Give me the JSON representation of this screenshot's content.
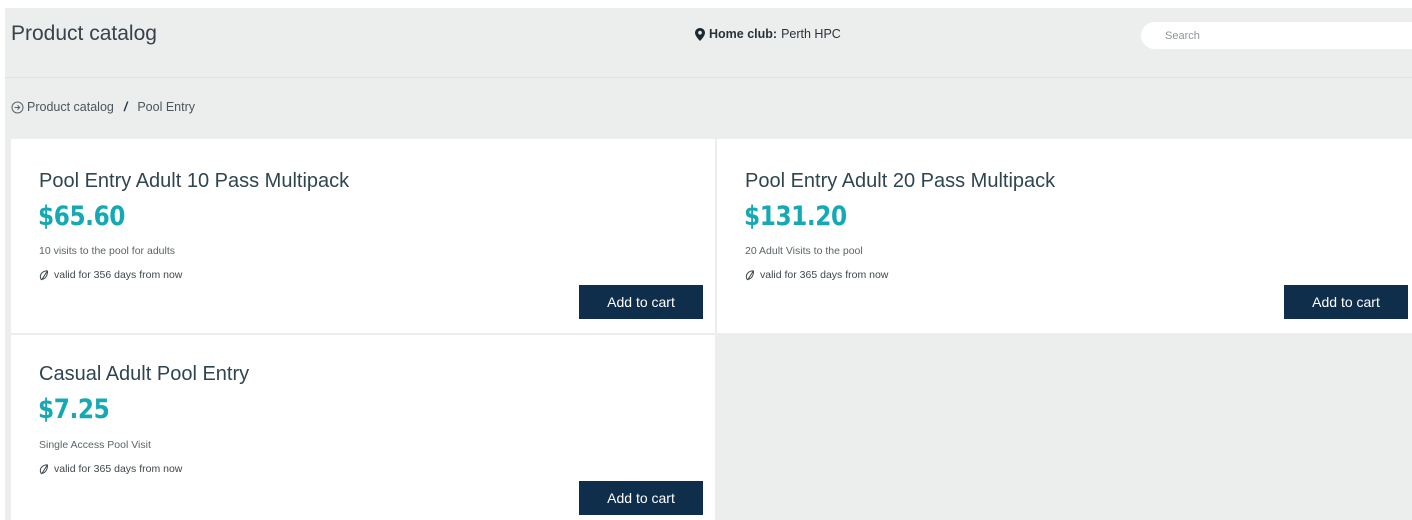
{
  "header": {
    "title": "Product catalog",
    "home_club_label": "Home club:",
    "home_club_value": "Perth HPC",
    "search_placeholder": "Search"
  },
  "breadcrumb": {
    "items": [
      "Product catalog",
      "Pool Entry"
    ],
    "separator": "/"
  },
  "products": [
    {
      "title": "Pool Entry Adult 10 Pass Multipack",
      "price": "$65.60",
      "description": "10 visits to the pool for adults",
      "validity": "valid for 356 days from  now",
      "button": "Add to cart"
    },
    {
      "title": "Pool Entry Adult 20 Pass Multipack",
      "price": "$131.20",
      "description": "20 Adult Visits to the pool",
      "validity": "valid for 365 days from  now",
      "button": "Add to cart"
    },
    {
      "title": "Casual Adult Pool Entry",
      "price": "$7.25",
      "description": "Single Access Pool Visit",
      "validity": "valid for 365 days from  now",
      "button": "Add to cart"
    }
  ],
  "colors": {
    "price": "#14a9b4",
    "button": "#0f2e4c",
    "page_bg": "#eceeee"
  },
  "icons": {
    "location": "map-pin-icon",
    "breadcrumb": "login-arrow-icon",
    "validity": "leaf-icon"
  }
}
